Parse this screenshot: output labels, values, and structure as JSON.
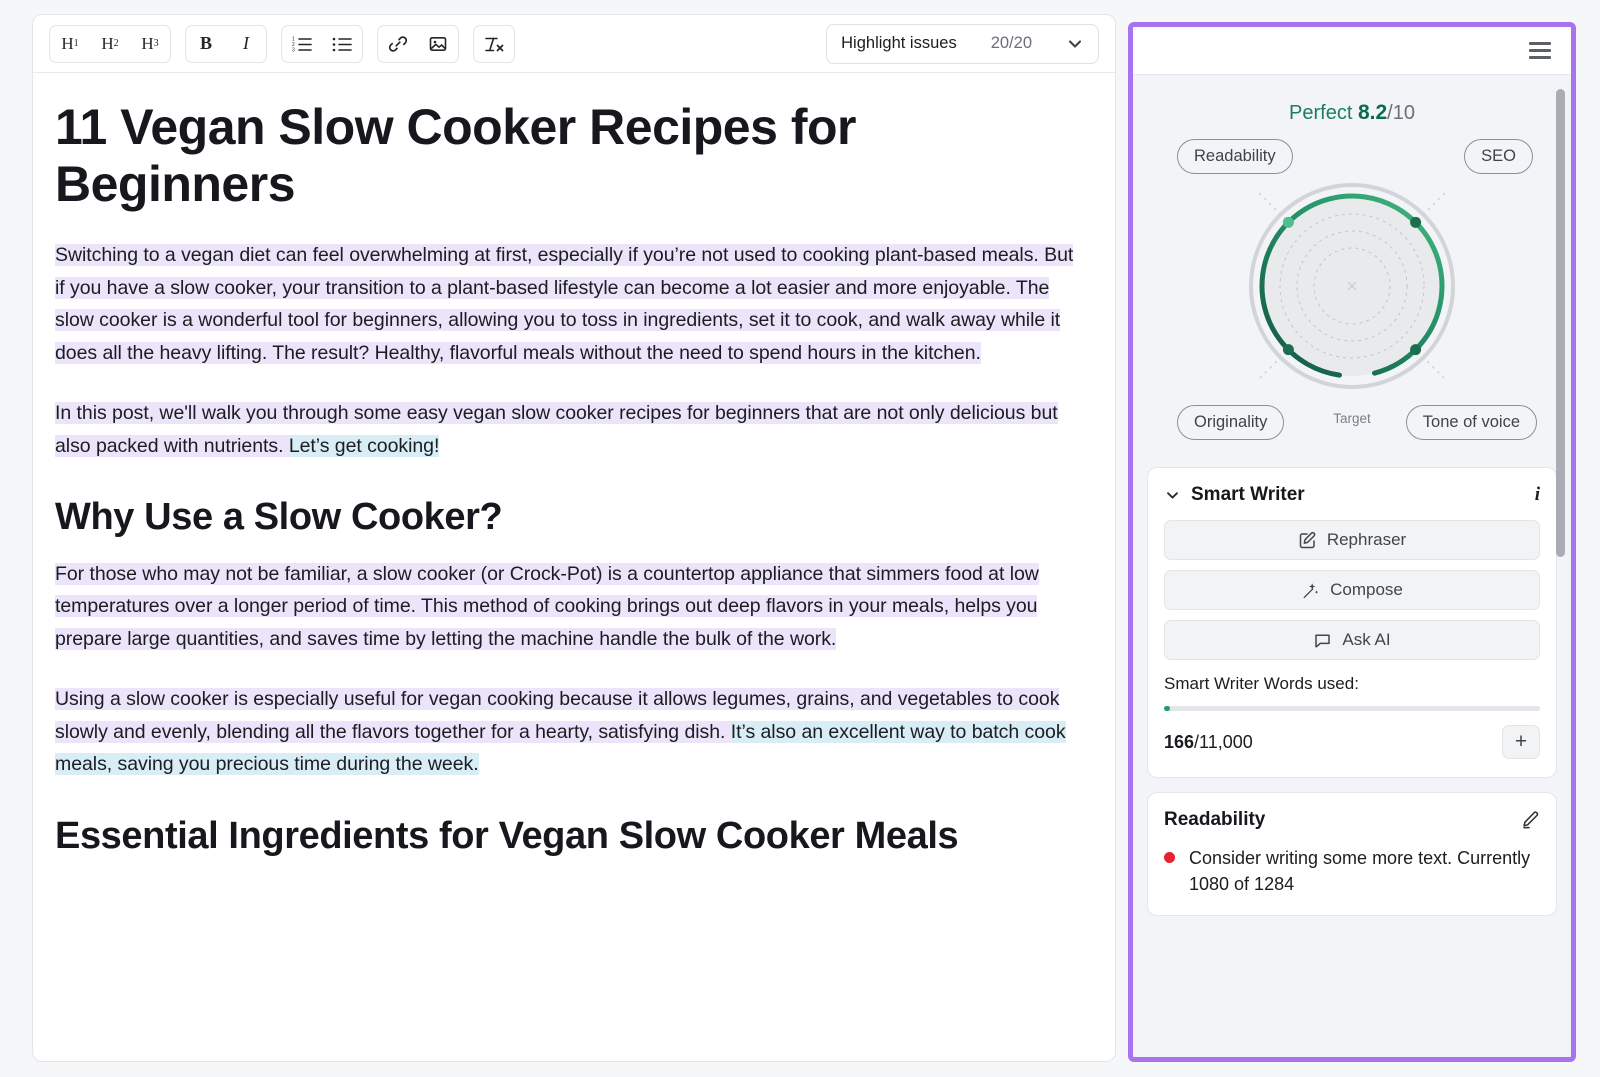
{
  "editor": {
    "toolbar": {
      "groups": [
        {
          "name": "headings",
          "buttons": [
            {
              "id": "h1",
              "label": "H",
              "sub": "1",
              "icon": "heading-1-icon"
            },
            {
              "id": "h2",
              "label": "H",
              "sub": "2",
              "icon": "heading-2-icon"
            },
            {
              "id": "h3",
              "label": "H",
              "sub": "3",
              "icon": "heading-3-icon"
            }
          ]
        },
        {
          "name": "style",
          "buttons": [
            {
              "id": "bold",
              "label": "B",
              "icon": "bold-icon"
            },
            {
              "id": "italic",
              "label": "I",
              "icon": "italic-icon"
            }
          ]
        },
        {
          "name": "lists",
          "buttons": [
            {
              "id": "ordered-list",
              "label": "",
              "icon": "ordered-list-icon"
            },
            {
              "id": "bullet-list",
              "label": "",
              "icon": "bullet-list-icon"
            }
          ]
        },
        {
          "name": "insert",
          "buttons": [
            {
              "id": "link",
              "label": "",
              "icon": "link-icon"
            },
            {
              "id": "image",
              "label": "",
              "icon": "image-icon"
            }
          ]
        },
        {
          "name": "clear",
          "buttons": [
            {
              "id": "clear-format",
              "label": "",
              "icon": "clear-formatting-icon"
            }
          ]
        }
      ],
      "highlight": {
        "label": "Highlight issues",
        "count": "20/20",
        "chevron": "chevron-down-icon"
      }
    },
    "document": {
      "title": "11 Vegan Slow Cooker Recipes for Beginners",
      "blocks": [
        {
          "type": "paragraph",
          "runs": [
            {
              "text": "Switching to a vegan diet can feel overwhelming at first, especially if you’re not used to cooking plant-based meals. But if you have a slow cooker, your transition to a plant-based lifestyle can become a lot easier and more enjoyable. The slow cooker is a wonderful tool for beginners, allowing you to toss in ingredients, set it to cook, and walk away while it does all the heavy lifting. The result? Healthy, flavorful meals without the need to spend hours in the kitchen.",
              "highlight": "purple"
            }
          ]
        },
        {
          "type": "paragraph",
          "runs": [
            {
              "text": "In this post, we'll walk you through some easy vegan slow cooker recipes for beginners that are not only delicious but also packed with nutrients. ",
              "highlight": "purple"
            },
            {
              "text": "Let’s get cooking!",
              "highlight": "blue"
            }
          ]
        },
        {
          "type": "heading2",
          "text": "Why Use a Slow Cooker?"
        },
        {
          "type": "paragraph",
          "runs": [
            {
              "text": "For those who may not be familiar, a slow cooker (or Crock-Pot) is a countertop appliance that simmers food at low temperatures over a longer period of time. This method of cooking brings out deep flavors in your meals, helps you prepare large quantities, and saves time by letting the machine handle the bulk of the work.",
              "highlight": "purple"
            }
          ]
        },
        {
          "type": "paragraph",
          "runs": [
            {
              "text": "Using a slow cooker is especially useful for vegan cooking because it allows legumes, grains, and vegetables to cook slowly and evenly, blending all the flavors together for a hearty, satisfying dish. ",
              "highlight": "purple"
            },
            {
              "text": "It’s also an excellent way to batch cook meals, saving you precious time during the week.",
              "highlight": "blue"
            }
          ]
        },
        {
          "type": "heading2",
          "text": "Essential Ingredients for Vegan Slow Cooker Meals"
        }
      ]
    }
  },
  "assistant": {
    "menu_icon": "hamburger-menu-icon",
    "score": {
      "word": "Perfect",
      "value": "8.2",
      "denominator": "/10"
    },
    "metrics": [
      {
        "id": "readability",
        "label": "Readability"
      },
      {
        "id": "seo",
        "label": "SEO"
      },
      {
        "id": "originality",
        "label": "Originality"
      },
      {
        "id": "tone-of-voice",
        "label": "Tone of voice"
      }
    ],
    "gauge": {
      "target_label": "Target",
      "arc_color_light": "#3aae7a",
      "arc_color_dark": "#1b6f50",
      "ring_color": "#cfd2d6"
    },
    "smart_writer": {
      "title": "Smart Writer",
      "collapse_icon": "chevron-down-icon",
      "info_icon": "info-icon",
      "actions": [
        {
          "id": "rephraser",
          "label": "Rephraser",
          "icon": "edit-square-icon"
        },
        {
          "id": "compose",
          "label": "Compose",
          "icon": "magic-wand-icon"
        },
        {
          "id": "ask-ai",
          "label": "Ask AI",
          "icon": "chat-bubble-icon"
        }
      ],
      "words_label": "Smart Writer Words used:",
      "words_used": "166",
      "words_total": "/11,000",
      "progress_percent": 1.5,
      "add_button": "+"
    },
    "readability_card": {
      "title": "Readability",
      "edit_icon": "pencil-icon",
      "issues": [
        {
          "severity_color": "#e8222e",
          "text": "Consider writing some more text. Currently 1080 of 1284"
        }
      ]
    }
  }
}
